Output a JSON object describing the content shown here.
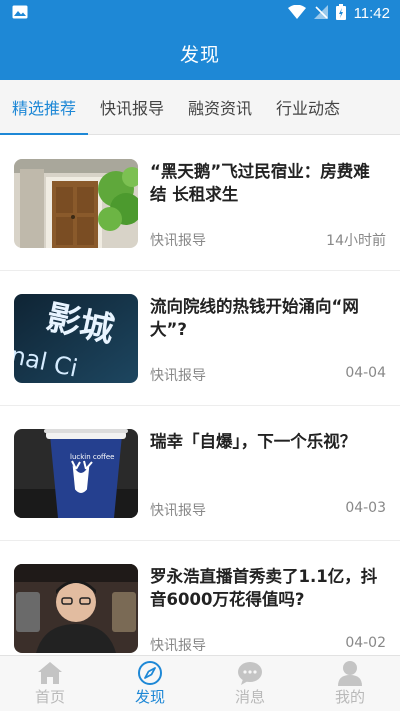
{
  "status": {
    "time": "11:42"
  },
  "header": {
    "title": "发现"
  },
  "tabs": [
    {
      "label": "精选推荐",
      "active": true
    },
    {
      "label": "快讯报导",
      "active": false
    },
    {
      "label": "融资资讯",
      "active": false
    },
    {
      "label": "行业动态",
      "active": false
    }
  ],
  "articles": [
    {
      "title": "“黑天鹅”飞过民宿业：房费难结 长租求生",
      "source": "快讯报导",
      "time": "14小时前"
    },
    {
      "title": "流向院线的热钱开始涌向“网大”?",
      "source": "快讯报导",
      "time": "04-04"
    },
    {
      "title": "瑞幸「自爆」，下一个乐视？",
      "source": "快讯报导",
      "time": "04-03"
    },
    {
      "title": "罗永浩直播首秀卖了1.1亿，抖音6000万花得值吗?",
      "source": "快讯报导",
      "time": "04-02"
    }
  ],
  "thumb_text": {
    "cinema": "影城",
    "cinema_en": "nal Ci",
    "coffee_brand": "luckin coffee"
  },
  "bottom_nav": [
    {
      "label": "首页",
      "icon": "home-icon",
      "active": false
    },
    {
      "label": "发现",
      "icon": "compass-icon",
      "active": true
    },
    {
      "label": "消息",
      "icon": "chat-icon",
      "active": false
    },
    {
      "label": "我的",
      "icon": "user-icon",
      "active": false
    }
  ],
  "colors": {
    "primary": "#1e88d6",
    "inactive": "#b9b9b9"
  }
}
